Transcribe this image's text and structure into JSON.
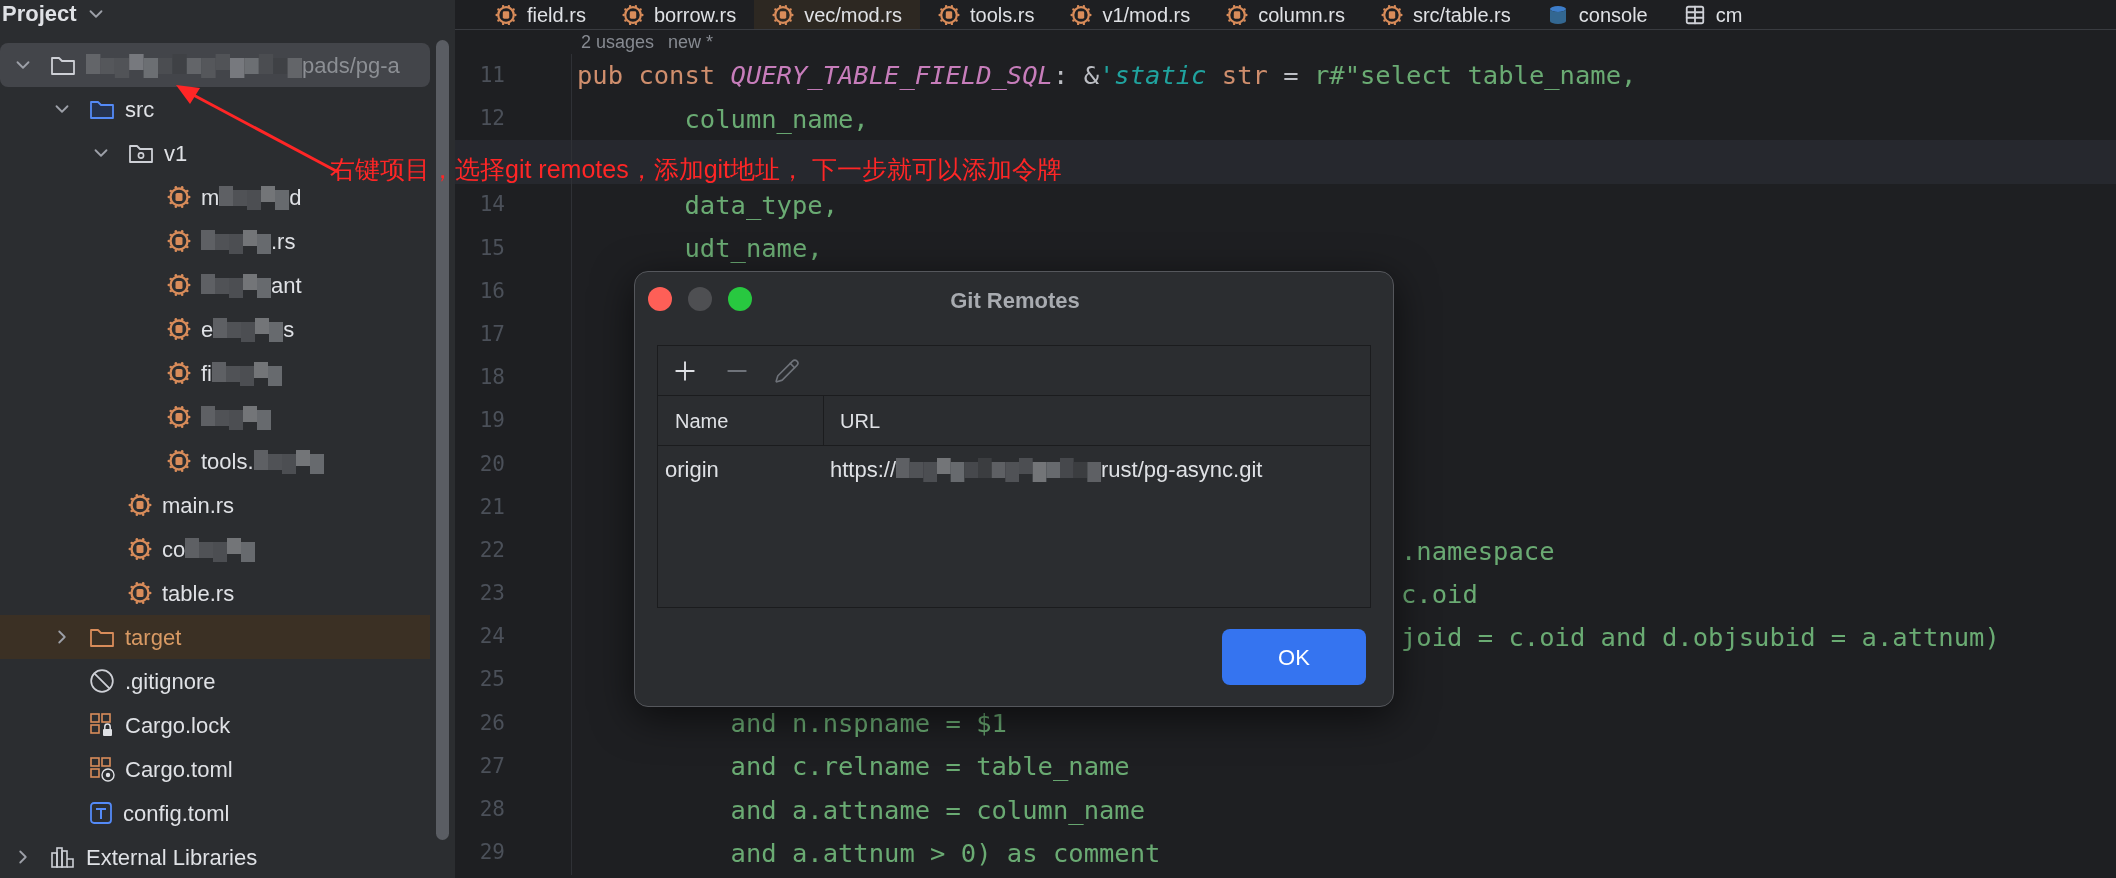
{
  "sidebar": {
    "title": "Project",
    "tree": [
      {
        "kind": "project",
        "redacted": true,
        "tail": "pads/pg-a",
        "expanded": true,
        "selected": true,
        "children": [
          {
            "kind": "source-folder",
            "text": "src",
            "redacted": false,
            "expanded": true,
            "selected": false,
            "children": [
              {
                "kind": "module-folder",
                "text": "v1",
                "redacted": false,
                "expanded": true,
                "selected": false,
                "children": [
                  {
                    "kind": "rust-file",
                    "text": "m",
                    "redacted": true,
                    "tail": "d",
                    "selected": false
                  },
                  {
                    "kind": "rust-file",
                    "redacted": true,
                    "tail": ".rs",
                    "selected": false
                  },
                  {
                    "kind": "rust-file",
                    "redacted": true,
                    "tail": "ant",
                    "selected": false
                  },
                  {
                    "kind": "rust-file",
                    "text": "e",
                    "redacted": true,
                    "tail": "s",
                    "selected": false
                  },
                  {
                    "kind": "rust-file",
                    "text": "fi",
                    "redacted": true,
                    "selected": false
                  },
                  {
                    "kind": "rust-file",
                    "redacted": true,
                    "selected": false
                  },
                  {
                    "kind": "rust-file",
                    "text": "tools.",
                    "redacted": true,
                    "selected": false
                  }
                ]
              },
              {
                "kind": "rust-file",
                "text": "main.rs",
                "redacted": false,
                "selected": false
              },
              {
                "kind": "rust-file",
                "text": "co",
                "redacted": true,
                "selected": false
              },
              {
                "kind": "rust-file",
                "text": "table.rs",
                "redacted": false,
                "selected": false
              }
            ]
          },
          {
            "kind": "excluded-folder",
            "text": "target",
            "redacted": false,
            "expanded": false,
            "selected": false
          },
          {
            "kind": "ignore-file",
            "text": ".gitignore",
            "redacted": false,
            "selected": false
          },
          {
            "kind": "cargo-lock",
            "text": "Cargo.lock",
            "redacted": false,
            "selected": false
          },
          {
            "kind": "cargo-toml",
            "text": "Cargo.toml",
            "redacted": false,
            "selected": false
          },
          {
            "kind": "toml-file",
            "text": "config.toml",
            "redacted": false,
            "selected": false
          }
        ]
      },
      {
        "kind": "library",
        "text": "External Libraries",
        "redacted": false,
        "expanded": false,
        "selected": false
      }
    ]
  },
  "tabs": [
    {
      "kind": "rust",
      "label": "field.rs",
      "selected": false
    },
    {
      "kind": "rust",
      "label": "borrow.rs",
      "selected": false
    },
    {
      "kind": "rust",
      "label": "vec/mod.rs",
      "selected": true
    },
    {
      "kind": "rust",
      "label": "tools.rs",
      "selected": false
    },
    {
      "kind": "rust",
      "label": "v1/mod.rs",
      "selected": false
    },
    {
      "kind": "rust",
      "label": "column.rs",
      "selected": false
    },
    {
      "kind": "rust",
      "label": "src/table.rs",
      "selected": false
    },
    {
      "kind": "console",
      "label": "console",
      "selected": false
    },
    {
      "kind": "table",
      "label": "cm",
      "selected": false
    }
  ],
  "inlay_hints": [
    "2 usages",
    "new *"
  ],
  "lines": [
    {
      "number": "11",
      "kind": "code",
      "current": false,
      "segments": [
        {
          "kind": "keyword",
          "text": "pub const "
        },
        {
          "kind": "constant",
          "text": "QUERY_TABLE_FIELD_SQL"
        },
        {
          "kind": "punct",
          "text": ": &"
        },
        {
          "kind": "lifetime",
          "text": "'static"
        },
        {
          "kind": "keyword",
          "text": " str"
        },
        {
          "kind": "punct",
          "text": " = "
        },
        {
          "kind": "string",
          "text": "r#\"select table_name,"
        }
      ]
    },
    {
      "number": "12",
      "kind": "code",
      "current": false,
      "segments": [
        {
          "kind": "string",
          "text": "       column_name,"
        }
      ]
    },
    {
      "kind": "empty",
      "current": true
    },
    {
      "number": "14",
      "kind": "code",
      "current": false,
      "segments": [
        {
          "kind": "string",
          "text": "       data_type,"
        }
      ]
    },
    {
      "number": "15",
      "kind": "code",
      "current": false,
      "segments": [
        {
          "kind": "string",
          "text": "       udt_name,"
        }
      ]
    },
    {
      "number": "16",
      "kind": "empty",
      "current": false
    },
    {
      "number": "17",
      "kind": "empty",
      "current": false
    },
    {
      "number": "18",
      "kind": "empty",
      "current": false
    },
    {
      "number": "19",
      "kind": "empty",
      "current": false
    },
    {
      "number": "20",
      "kind": "empty",
      "current": false
    },
    {
      "number": "21",
      "kind": "empty",
      "current": false
    },
    {
      "number": "22",
      "kind": "partial",
      "current": false,
      "segments": [
        {
          "kind": "string",
          "text": ".namespace"
        }
      ]
    },
    {
      "number": "23",
      "kind": "partial",
      "current": false,
      "segments": [
        {
          "kind": "string",
          "text": "c.oid"
        }
      ]
    },
    {
      "number": "24",
      "kind": "partial",
      "current": false,
      "segments": [
        {
          "kind": "string",
          "text": "joid = c.oid and d.objsubid = a.attnum)"
        }
      ]
    },
    {
      "number": "25",
      "kind": "empty",
      "current": false
    },
    {
      "number": "26",
      "kind": "code",
      "current": false,
      "segments": [
        {
          "kind": "string",
          "text": "          and n.nspname = $1"
        }
      ]
    },
    {
      "number": "27",
      "kind": "code",
      "current": false,
      "segments": [
        {
          "kind": "string",
          "text": "          and c.relname = table_name"
        }
      ]
    },
    {
      "number": "28",
      "kind": "code",
      "current": false,
      "segments": [
        {
          "kind": "string",
          "text": "          and a.attname = column_name"
        }
      ]
    },
    {
      "number": "29",
      "kind": "code",
      "current": false,
      "segments": [
        {
          "kind": "string",
          "text": "          and a.attnum > 0) as comment"
        }
      ]
    }
  ],
  "annotation": "右键项目，选择git remotes，添加git地址， 下一步就可以添加令牌",
  "dialog": {
    "title": "Git Remotes",
    "toolbar": [
      {
        "kind": "add",
        "disabled": false
      },
      {
        "kind": "remove",
        "disabled": true
      },
      {
        "kind": "edit",
        "disabled": true
      }
    ],
    "columns": [
      "Name",
      "URL"
    ],
    "rows": [
      {
        "name": "origin",
        "url_prefix": "https://",
        "url_redacted": true,
        "url_suffix": "rust/pg-async.git"
      }
    ],
    "ok_button": "OK"
  }
}
